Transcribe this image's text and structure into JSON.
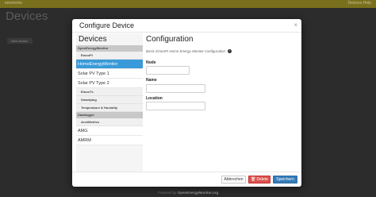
{
  "app": {
    "brand": "emoncms",
    "page_title": "Devices",
    "top_right_link": "Devices Help",
    "new_device_button": "New device",
    "footer_prefix": "Powered by",
    "footer_link": "OpenEnergyMonitor.org"
  },
  "modal": {
    "title": "Configure Device",
    "close_glyph": "×",
    "sidebar": {
      "heading": "Devices",
      "items": [
        {
          "label": "OpenEnergyMonitor",
          "kind": "group"
        },
        {
          "label": "EmonPi",
          "kind": "sub"
        },
        {
          "label": "HomeEnergyMonitor",
          "kind": "item",
          "active": true
        },
        {
          "label": "Solar PV Type 1",
          "kind": "item"
        },
        {
          "label": "Solar PV Type 2",
          "kind": "item"
        },
        {
          "label": "EmonTx",
          "kind": "sub"
        },
        {
          "label": "Smartplug",
          "kind": "sub"
        },
        {
          "label": "Temperature & Humidity",
          "kind": "sub"
        },
        {
          "label": "Datalogger",
          "kind": "group"
        },
        {
          "label": "ArchMetrics",
          "kind": "sub"
        },
        {
          "label": "AMG",
          "kind": "item"
        },
        {
          "label": "AMRM",
          "kind": "item"
        }
      ]
    },
    "configuration": {
      "heading": "Configuration",
      "description": "Basic EmonPi Home Energy Monitor configuration",
      "info_glyph": "i",
      "fields": {
        "node": {
          "label": "Node",
          "value": ""
        },
        "name": {
          "label": "Name",
          "value": ""
        },
        "location": {
          "label": "Location",
          "value": ""
        }
      }
    },
    "footer": {
      "cancel_label": "Abbrechen",
      "delete_label": "Delete",
      "save_label": "Speichern"
    }
  },
  "colors": {
    "active_item": "#3a9ad9",
    "delete_button": "#d9534f",
    "save_button": "#337ab7",
    "topbar": "#7a6f1c"
  }
}
